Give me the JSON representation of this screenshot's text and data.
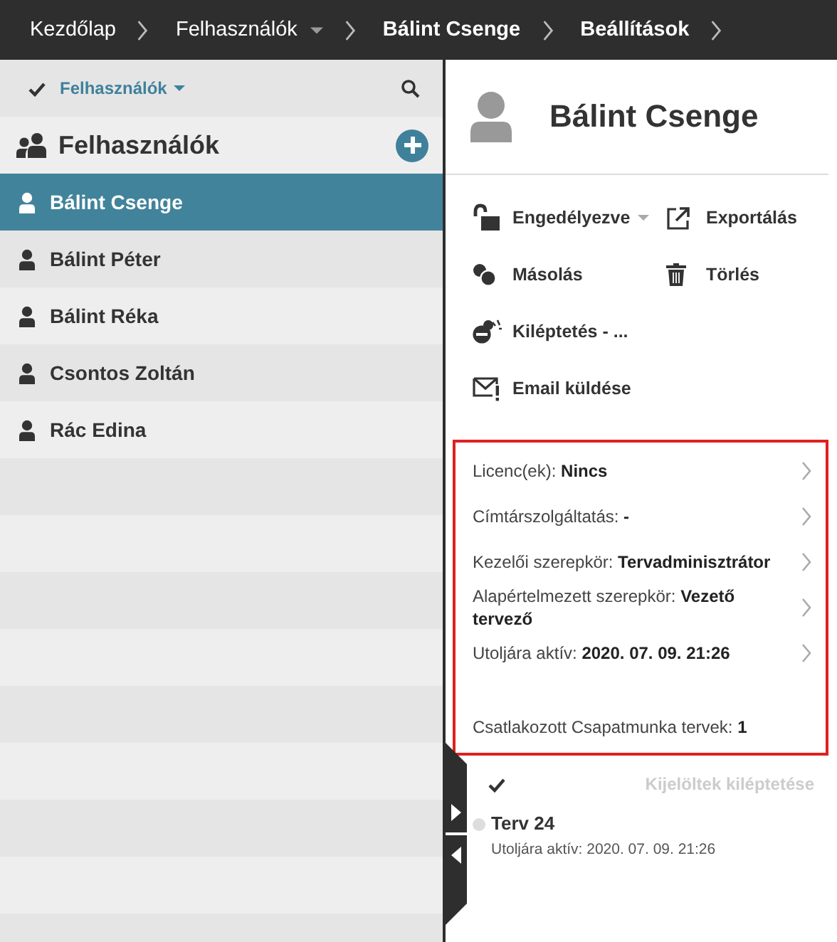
{
  "breadcrumbs": [
    {
      "label": "Kezdőlap",
      "bold": false,
      "dropdown": false
    },
    {
      "label": "Felhasználók",
      "bold": false,
      "dropdown": true
    },
    {
      "label": "Bálint Csenge",
      "bold": true,
      "dropdown": false
    },
    {
      "label": "Beállítások",
      "bold": true,
      "dropdown": false
    }
  ],
  "sidebar": {
    "filter": {
      "label": "Felhasználók",
      "checked": true
    },
    "title": "Felhasználók",
    "users": [
      {
        "name": "Bálint Csenge",
        "selected": true
      },
      {
        "name": "Bálint Péter",
        "selected": false
      },
      {
        "name": "Bálint Réka",
        "selected": false
      },
      {
        "name": "Csontos Zoltán",
        "selected": false
      },
      {
        "name": "Rác Edina",
        "selected": false
      }
    ]
  },
  "profile": {
    "name": "Bálint Csenge",
    "action_rows": [
      [
        {
          "label": "Engedélyezve",
          "kind": "lock",
          "dropdown": true
        },
        {
          "label": "Exportálás",
          "kind": "export",
          "dropdown": false
        }
      ],
      [
        {
          "label": "Másolás",
          "kind": "copy",
          "dropdown": false
        },
        {
          "label": "Törlés",
          "kind": "trash",
          "dropdown": false
        }
      ],
      [
        {
          "label": "Kiléptetés - ...",
          "kind": "logout",
          "dropdown": false
        }
      ],
      [
        {
          "label": "Email küldése",
          "kind": "email",
          "dropdown": false
        }
      ]
    ]
  },
  "details": [
    {
      "label": "Licenc(ek):",
      "value": "Nincs",
      "arrow": true
    },
    {
      "label": "Címtárszolgáltatás:",
      "value": "-",
      "arrow": true
    },
    {
      "label": "Kezelői szerepkör:",
      "value": "Tervadminisztrátor",
      "arrow": true
    },
    {
      "label": "Alapértelmezett szerepkör:",
      "value": "Vezető tervező",
      "arrow": true
    },
    {
      "label": "Utoljára aktív:",
      "value": "2020. 07. 09. 21:26",
      "arrow": true
    },
    {
      "label": "Csatlakozott Csapatmunka tervek:",
      "value": "1",
      "arrow": false
    }
  ],
  "projects": {
    "select_all": {
      "checked": true
    },
    "bulk_action": {
      "label": "Kijelöltek kiléptetése",
      "disabled": true
    },
    "items": [
      {
        "name": "Terv 24",
        "subtitle": "Utoljára aktív: 2020. 07. 09. 21:26"
      }
    ]
  }
}
